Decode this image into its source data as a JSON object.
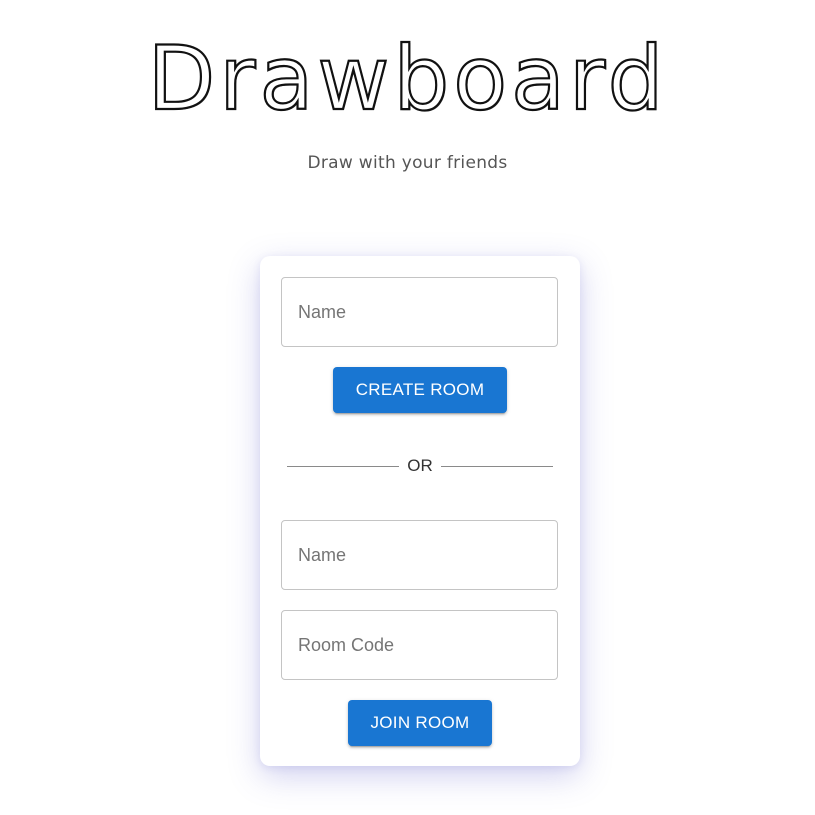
{
  "app": {
    "title": "Drawboard",
    "subtitle": "Draw with your friends"
  },
  "create": {
    "name_placeholder": "Name",
    "name_value": "",
    "button_label": "CREATE ROOM"
  },
  "separator": {
    "label": "OR"
  },
  "join": {
    "name_placeholder": "Name",
    "name_value": "",
    "room_code_placeholder": "Room Code",
    "room_code_value": "",
    "button_label": "JOIN ROOM"
  },
  "colors": {
    "primary": "#1976d2",
    "card_shadow": "#5a5ac8",
    "border": "#c4c4c4",
    "subtitle_text": "#555555"
  }
}
